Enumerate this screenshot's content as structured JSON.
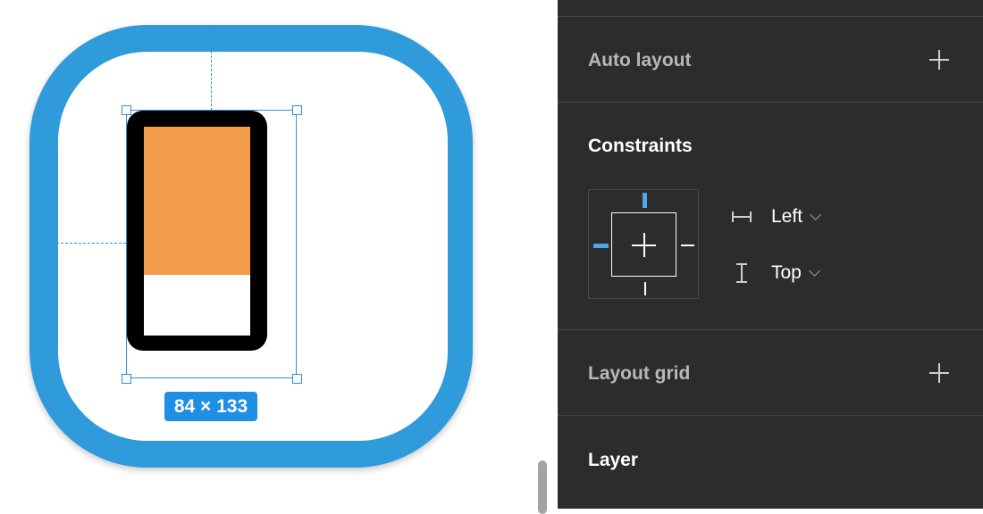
{
  "canvas": {
    "selection_size": "84 × 133",
    "colors": {
      "icon_background": "#2f9bdb",
      "phone_body": "#000000",
      "phone_screen_top": "#f29b4b",
      "phone_screen_bottom": "#ffffff",
      "selection": "#2f8fdf"
    }
  },
  "panel": {
    "auto_layout": {
      "title": "Auto layout",
      "add_icon": "plus-icon"
    },
    "constraints": {
      "title": "Constraints",
      "horizontal": {
        "value": "Left",
        "icon": "horizontal-constraint-icon"
      },
      "vertical": {
        "value": "Top",
        "icon": "vertical-constraint-icon"
      },
      "active_sides": [
        "top",
        "left"
      ]
    },
    "layout_grid": {
      "title": "Layout grid",
      "add_icon": "plus-icon"
    },
    "layer": {
      "title": "Layer"
    }
  }
}
